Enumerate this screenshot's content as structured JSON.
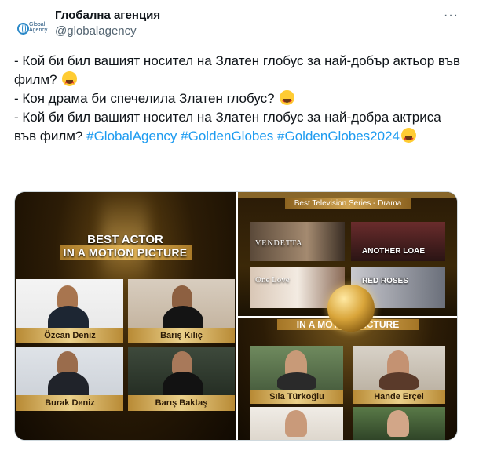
{
  "account": {
    "name": "Глобална агенция",
    "handle": "@globalagency",
    "avatar_logo_text": "Global Agency"
  },
  "tweet": {
    "line1": "- Кой би бил вашият носител на Златен глобус за най-добър актьор във филм?",
    "line2": "- Коя драма би спечелила Златен глобус?",
    "line3": "- Кой би бил вашият носител на Златен глобус за най-добра актриса във филм?",
    "hashtags": [
      "#GlobalAgency",
      "#GoldenGlobes",
      "#GoldenGlobes2024"
    ],
    "emoji": "star-struck-emoji"
  },
  "more_menu_glyph": "···",
  "media": {
    "left_panel": {
      "title_line1": "BEST ACTOR",
      "title_line2": "IN A MOTION PICTURE",
      "nominees": [
        "Özcan Deniz",
        "Barış Kılıç",
        "Burak Deniz",
        "Barış Baktaş"
      ]
    },
    "right_top_panel": {
      "subtitle": "Best Television Series - Drama",
      "posters": [
        "VENDETTA",
        "ANOTHER LOAE",
        "One Love",
        "RED ROSES"
      ]
    },
    "right_bottom_panel": {
      "title": "IN A MOTION PICTURE",
      "nominees": [
        "Sıla Türkoğlu",
        "Hande Erçel"
      ]
    }
  },
  "colors": {
    "hashtag": "#1d9bf0",
    "gold": "#d9a53a",
    "text": "#0f1419",
    "secondary": "#536471"
  }
}
